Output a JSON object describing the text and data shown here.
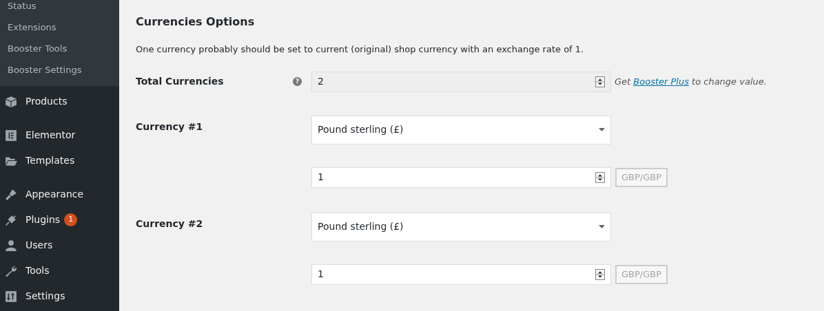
{
  "sidebar": {
    "submenu": [
      {
        "label": "Status"
      },
      {
        "label": "Extensions"
      },
      {
        "label": "Booster Tools"
      },
      {
        "label": "Booster Settings"
      }
    ],
    "menu_groups": [
      [
        {
          "label": "Products"
        }
      ],
      [
        {
          "label": "Elementor"
        },
        {
          "label": "Templates"
        }
      ],
      [
        {
          "label": "Appearance"
        },
        {
          "label": "Plugins",
          "badge": "1"
        },
        {
          "label": "Users"
        },
        {
          "label": "Tools"
        },
        {
          "label": "Settings"
        }
      ]
    ]
  },
  "section": {
    "title": "Currencies Options",
    "description": "One currency probably should be set to current (original) shop currency with an exchange rate of 1."
  },
  "total": {
    "label": "Total Currencies",
    "help": "?",
    "value": "2",
    "disabled": true,
    "note_before": "Get",
    "note_link": "Booster Plus",
    "note_after": "to change value."
  },
  "currencies": [
    {
      "label": "Currency #1",
      "currency": "Pound sterling (£)",
      "rate": "1",
      "pair": "GBP/GBP"
    },
    {
      "label": "Currency #2",
      "currency": "Pound sterling (£)",
      "rate": "1",
      "pair": "GBP/GBP"
    }
  ]
}
